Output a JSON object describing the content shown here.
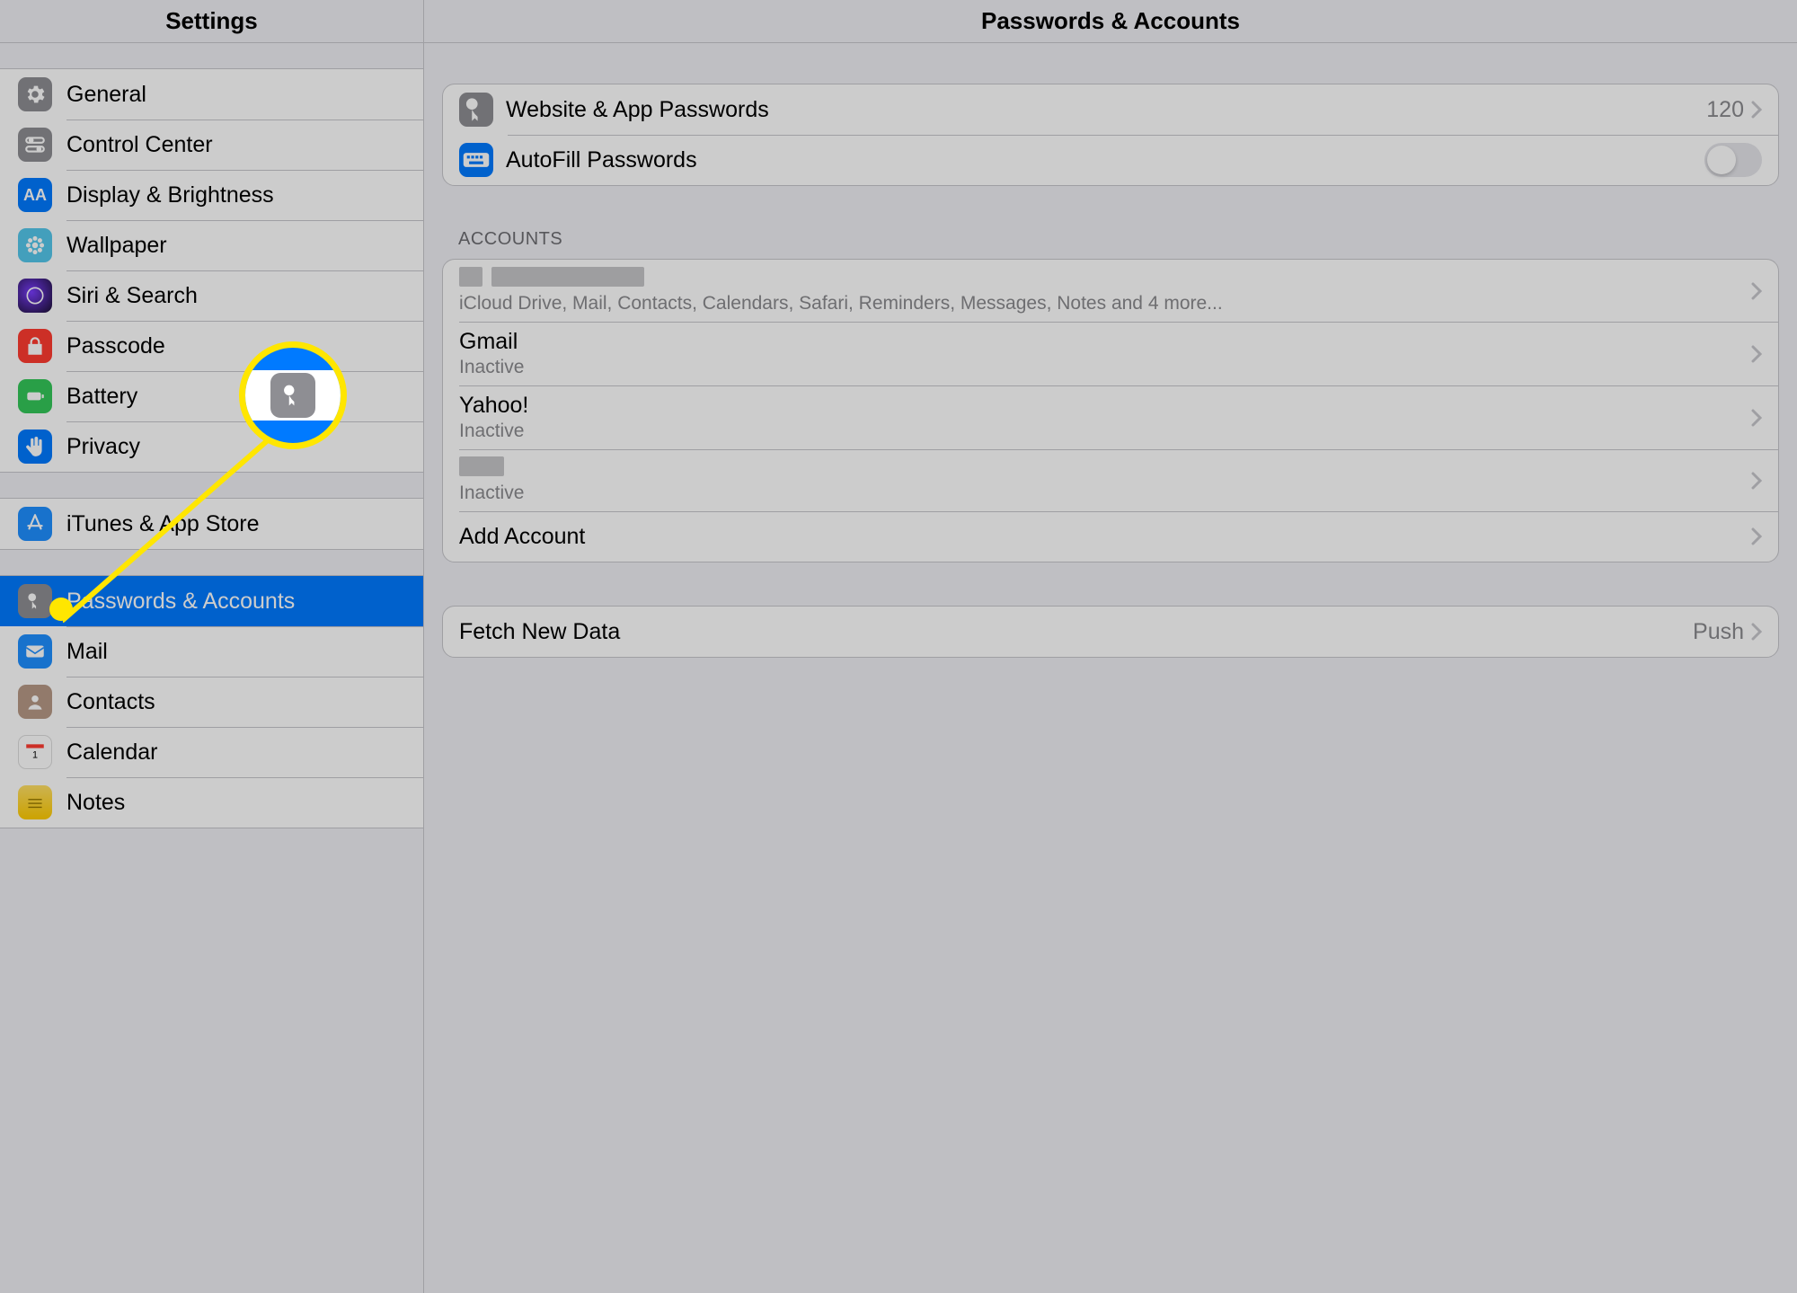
{
  "sidebar": {
    "title": "Settings",
    "groups": [
      {
        "items": [
          {
            "label": "General",
            "icon": "gear-icon",
            "bg": "#8e8e93",
            "fg": "#ffffff"
          },
          {
            "label": "Control Center",
            "icon": "switches-icon",
            "bg": "#8e8e93",
            "fg": "#ffffff"
          },
          {
            "label": "Display & Brightness",
            "icon": "aa-icon",
            "bg": "#007aff",
            "fg": "#ffffff"
          },
          {
            "label": "Wallpaper",
            "icon": "flower-icon",
            "bg": "#54c7ec",
            "fg": "#ffffff"
          },
          {
            "label": "Siri & Search",
            "icon": "siri-icon",
            "bg": "#000000",
            "fg": "#ffffff"
          },
          {
            "label": "Passcode",
            "icon": "lock-icon",
            "bg": "#ff3b30",
            "fg": "#ffffff"
          },
          {
            "label": "Battery",
            "icon": "battery-icon",
            "bg": "#34c759",
            "fg": "#ffffff"
          },
          {
            "label": "Privacy",
            "icon": "hand-icon",
            "bg": "#007aff",
            "fg": "#ffffff"
          }
        ]
      },
      {
        "items": [
          {
            "label": "iTunes & App Store",
            "icon": "appstore-icon",
            "bg": "#1f8fff",
            "fg": "#ffffff"
          }
        ]
      },
      {
        "items": [
          {
            "label": "Passwords & Accounts",
            "icon": "key-icon",
            "bg": "#8e8e93",
            "fg": "#ffffff",
            "selected": true
          },
          {
            "label": "Mail",
            "icon": "mail-icon",
            "bg": "#1f8fff",
            "fg": "#ffffff"
          },
          {
            "label": "Contacts",
            "icon": "contacts-icon",
            "bg": "#b79986",
            "fg": "#ffffff"
          },
          {
            "label": "Calendar",
            "icon": "calendar-icon",
            "bg": "#ffffff",
            "fg": "#ff3b30"
          },
          {
            "label": "Notes",
            "icon": "notes-icon",
            "bg": "#ffcc00",
            "fg": "#8a6d00"
          }
        ]
      }
    ]
  },
  "detail": {
    "title": "Passwords & Accounts",
    "passwords_group": {
      "website_label": "Website & App Passwords",
      "website_count": "120",
      "autofill_label": "AutoFill Passwords",
      "autofill_on": false
    },
    "accounts_header": "ACCOUNTS",
    "accounts": [
      {
        "title_redacted": true,
        "subtitle": "iCloud Drive, Mail, Contacts, Calendars, Safari, Reminders, Messages, Notes and 4 more..."
      },
      {
        "title": "Gmail",
        "subtitle": "Inactive"
      },
      {
        "title": "Yahoo!",
        "subtitle": "Inactive"
      },
      {
        "title_redacted": true,
        "subtitle": "Inactive"
      }
    ],
    "add_account_label": "Add Account",
    "fetch_group": {
      "label": "Fetch New Data",
      "value": "Push"
    }
  }
}
